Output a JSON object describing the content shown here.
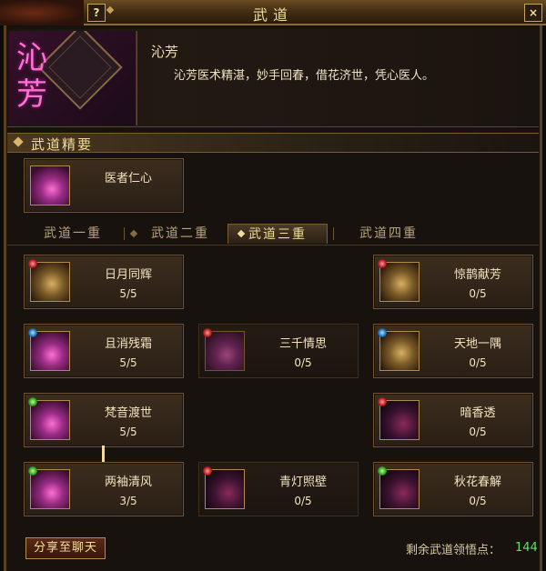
{
  "window": {
    "title": "武道",
    "help_icon": "?",
    "close_icon": "×"
  },
  "sect": {
    "name": "沁芳",
    "emblem_text": "沁芳",
    "description": "沁芳医术精湛，妙手回春，借花济世，凭心医人。"
  },
  "essentials": {
    "heading": "武道精要",
    "card": {
      "name": "医者仁心",
      "icon": "pink-flower-swirl"
    }
  },
  "tabs": [
    {
      "label": "武道一重",
      "active": false
    },
    {
      "label": "武道二重",
      "active": false
    },
    {
      "label": "武道三重",
      "active": true
    },
    {
      "label": "武道四重",
      "active": false
    }
  ],
  "skills": {
    "r1c1": {
      "name": "日月同辉",
      "level": "5/5",
      "orb": "red"
    },
    "r1c3": {
      "name": "惊鹊献芳",
      "level": "0/5",
      "orb": "red"
    },
    "r2c1": {
      "name": "且消残霜",
      "level": "5/5",
      "orb": "blue"
    },
    "r2c2": {
      "name": "三千情思",
      "level": "0/5",
      "orb": "red"
    },
    "r2c3": {
      "name": "天地一隅",
      "level": "0/5",
      "orb": "blue"
    },
    "r3c1": {
      "name": "梵音渡世",
      "level": "5/5",
      "orb": "green"
    },
    "r3c3": {
      "name": "暗香透",
      "level": "0/5",
      "orb": "red"
    },
    "r4c1": {
      "name": "两袖清风",
      "level": "3/5",
      "orb": "green"
    },
    "r4c2": {
      "name": "青灯照壁",
      "level": "0/5",
      "orb": "red"
    },
    "r4c3": {
      "name": "秋花春解",
      "level": "0/5",
      "orb": "green"
    }
  },
  "footer": {
    "share_label": "分享至聊天",
    "remaining_label": "剩余武道领悟点：",
    "remaining_value": "144"
  },
  "colors": {
    "accent_gold": "#f3dc9a",
    "points_green": "#5fe06a",
    "frame_brown": "#5a4020"
  }
}
